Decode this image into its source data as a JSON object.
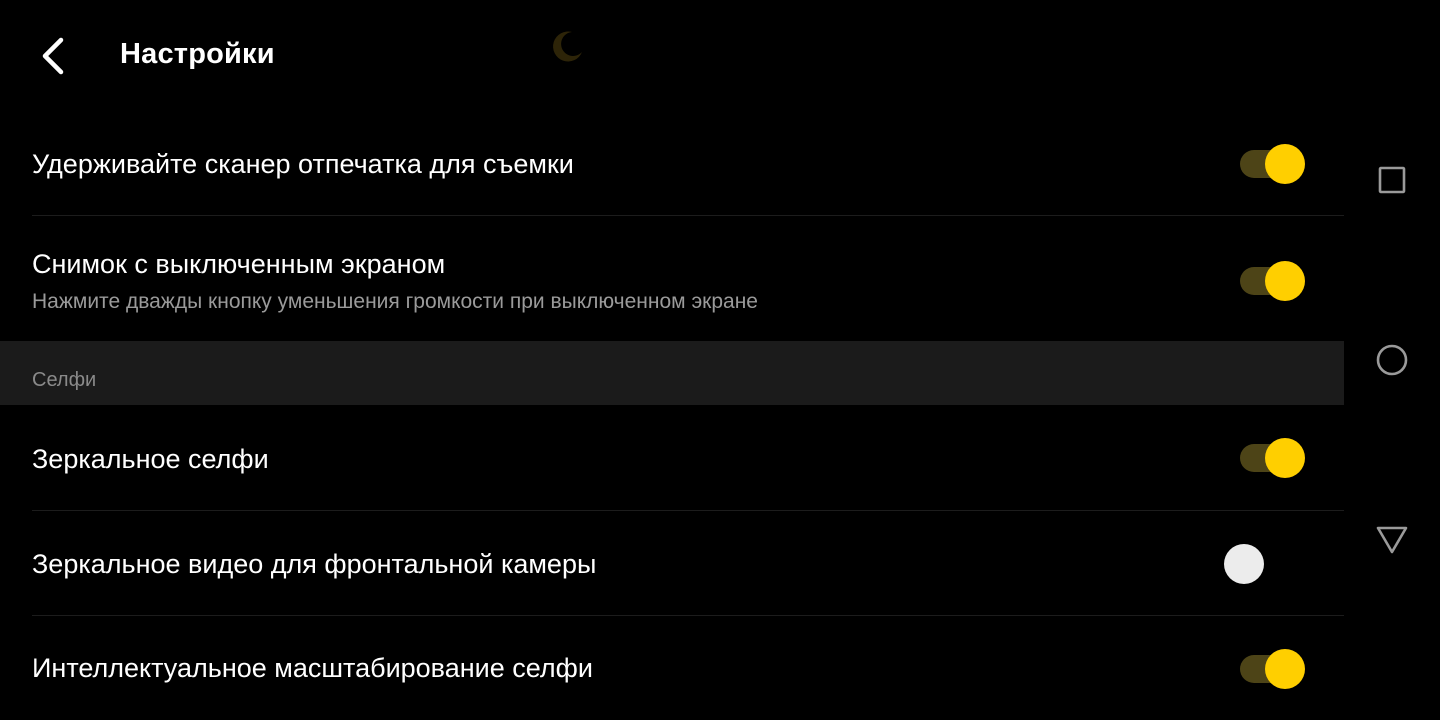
{
  "header": {
    "title": "Настройки",
    "back_icon": "back-arrow-icon",
    "night_icon": "moon-icon"
  },
  "settings": [
    {
      "title": "Удерживайте сканер отпечатка для съемки",
      "subtitle": "",
      "enabled": true
    },
    {
      "title": "Снимок с выключенным экраном",
      "subtitle": "Нажмите дважды кнопку уменьшения громкости при выключенном экране",
      "enabled": true
    }
  ],
  "selfie_section": {
    "label": "Селфи",
    "items": [
      {
        "title": "Зеркальное селфи",
        "enabled": true
      },
      {
        "title": "Зеркальное видео для фронтальной камеры",
        "enabled": false
      },
      {
        "title": "Интеллектуальное масштабирование селфи",
        "enabled": true
      }
    ]
  },
  "navbar": {
    "buttons": [
      "recents-square-icon",
      "home-circle-icon",
      "back-triangle-icon"
    ]
  },
  "colors": {
    "background": "#000000",
    "accent": "#ffcf00",
    "track_on": "#4d4417",
    "section_bg": "#1b1b1b",
    "secondary_text": "#9a9a9a"
  }
}
